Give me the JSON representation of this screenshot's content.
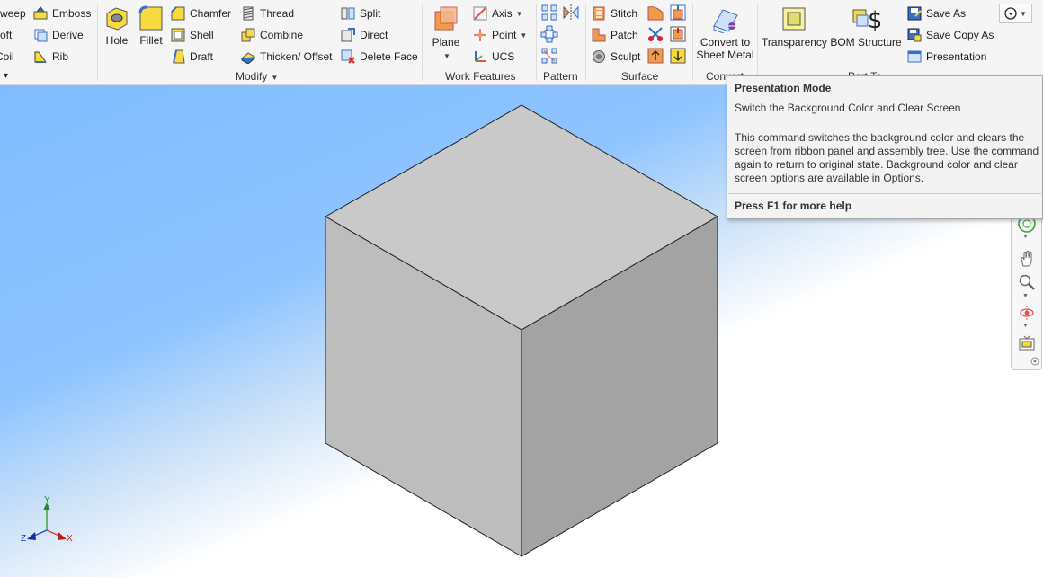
{
  "ribbon": {
    "create": {
      "items": [
        "weep",
        "oft",
        "Coil",
        "Emboss",
        "Derive",
        "Rib"
      ],
      "panel_caret": "▾"
    },
    "modify": {
      "label": "Modify",
      "large": [
        "Hole",
        "Fillet"
      ],
      "items": [
        "Chamfer",
        "Shell",
        "Draft",
        "Thread",
        "Combine",
        "Thicken/ Offset",
        "Split",
        "Direct",
        "Delete Face"
      ]
    },
    "work_features": {
      "label": "Work Features",
      "plane": "Plane",
      "items": [
        "Axis",
        "Point",
        "UCS"
      ]
    },
    "pattern": {
      "label": "Pattern"
    },
    "surface": {
      "label": "Surface",
      "items": [
        "Stitch",
        "Patch",
        "Sculpt"
      ]
    },
    "convert": {
      "label": "Convert",
      "button": [
        "Convert to",
        "Sheet Metal"
      ]
    },
    "part_tools": {
      "label": "Part To",
      "transparency": "Transparency",
      "bom": "BOM Structure",
      "items": [
        "Save As",
        "Save Copy As",
        "Presentation"
      ]
    }
  },
  "tooltip": {
    "title": "Presentation Mode",
    "subtitle": "Switch the Background Color and Clear Screen",
    "body": "This command switches the background color and clears the screen from ribbon panel and assembly tree. Use the command again to return to original state. Background color and clear screen options are available in Options.",
    "help": "Press F1 for more help"
  },
  "triad": {
    "x": "X",
    "y": "Y",
    "z": "Z"
  },
  "colors": {
    "viewport_top": "#7fbcff",
    "viewport_bottom": "#ffffff",
    "cube_top": "#c9c9c9",
    "cube_left": "#bdbdbd",
    "cube_right": "#a3a3a3",
    "icon_orange": "#f09a4a",
    "icon_yellow": "#f7d940",
    "icon_blue": "#3a6fc7"
  }
}
